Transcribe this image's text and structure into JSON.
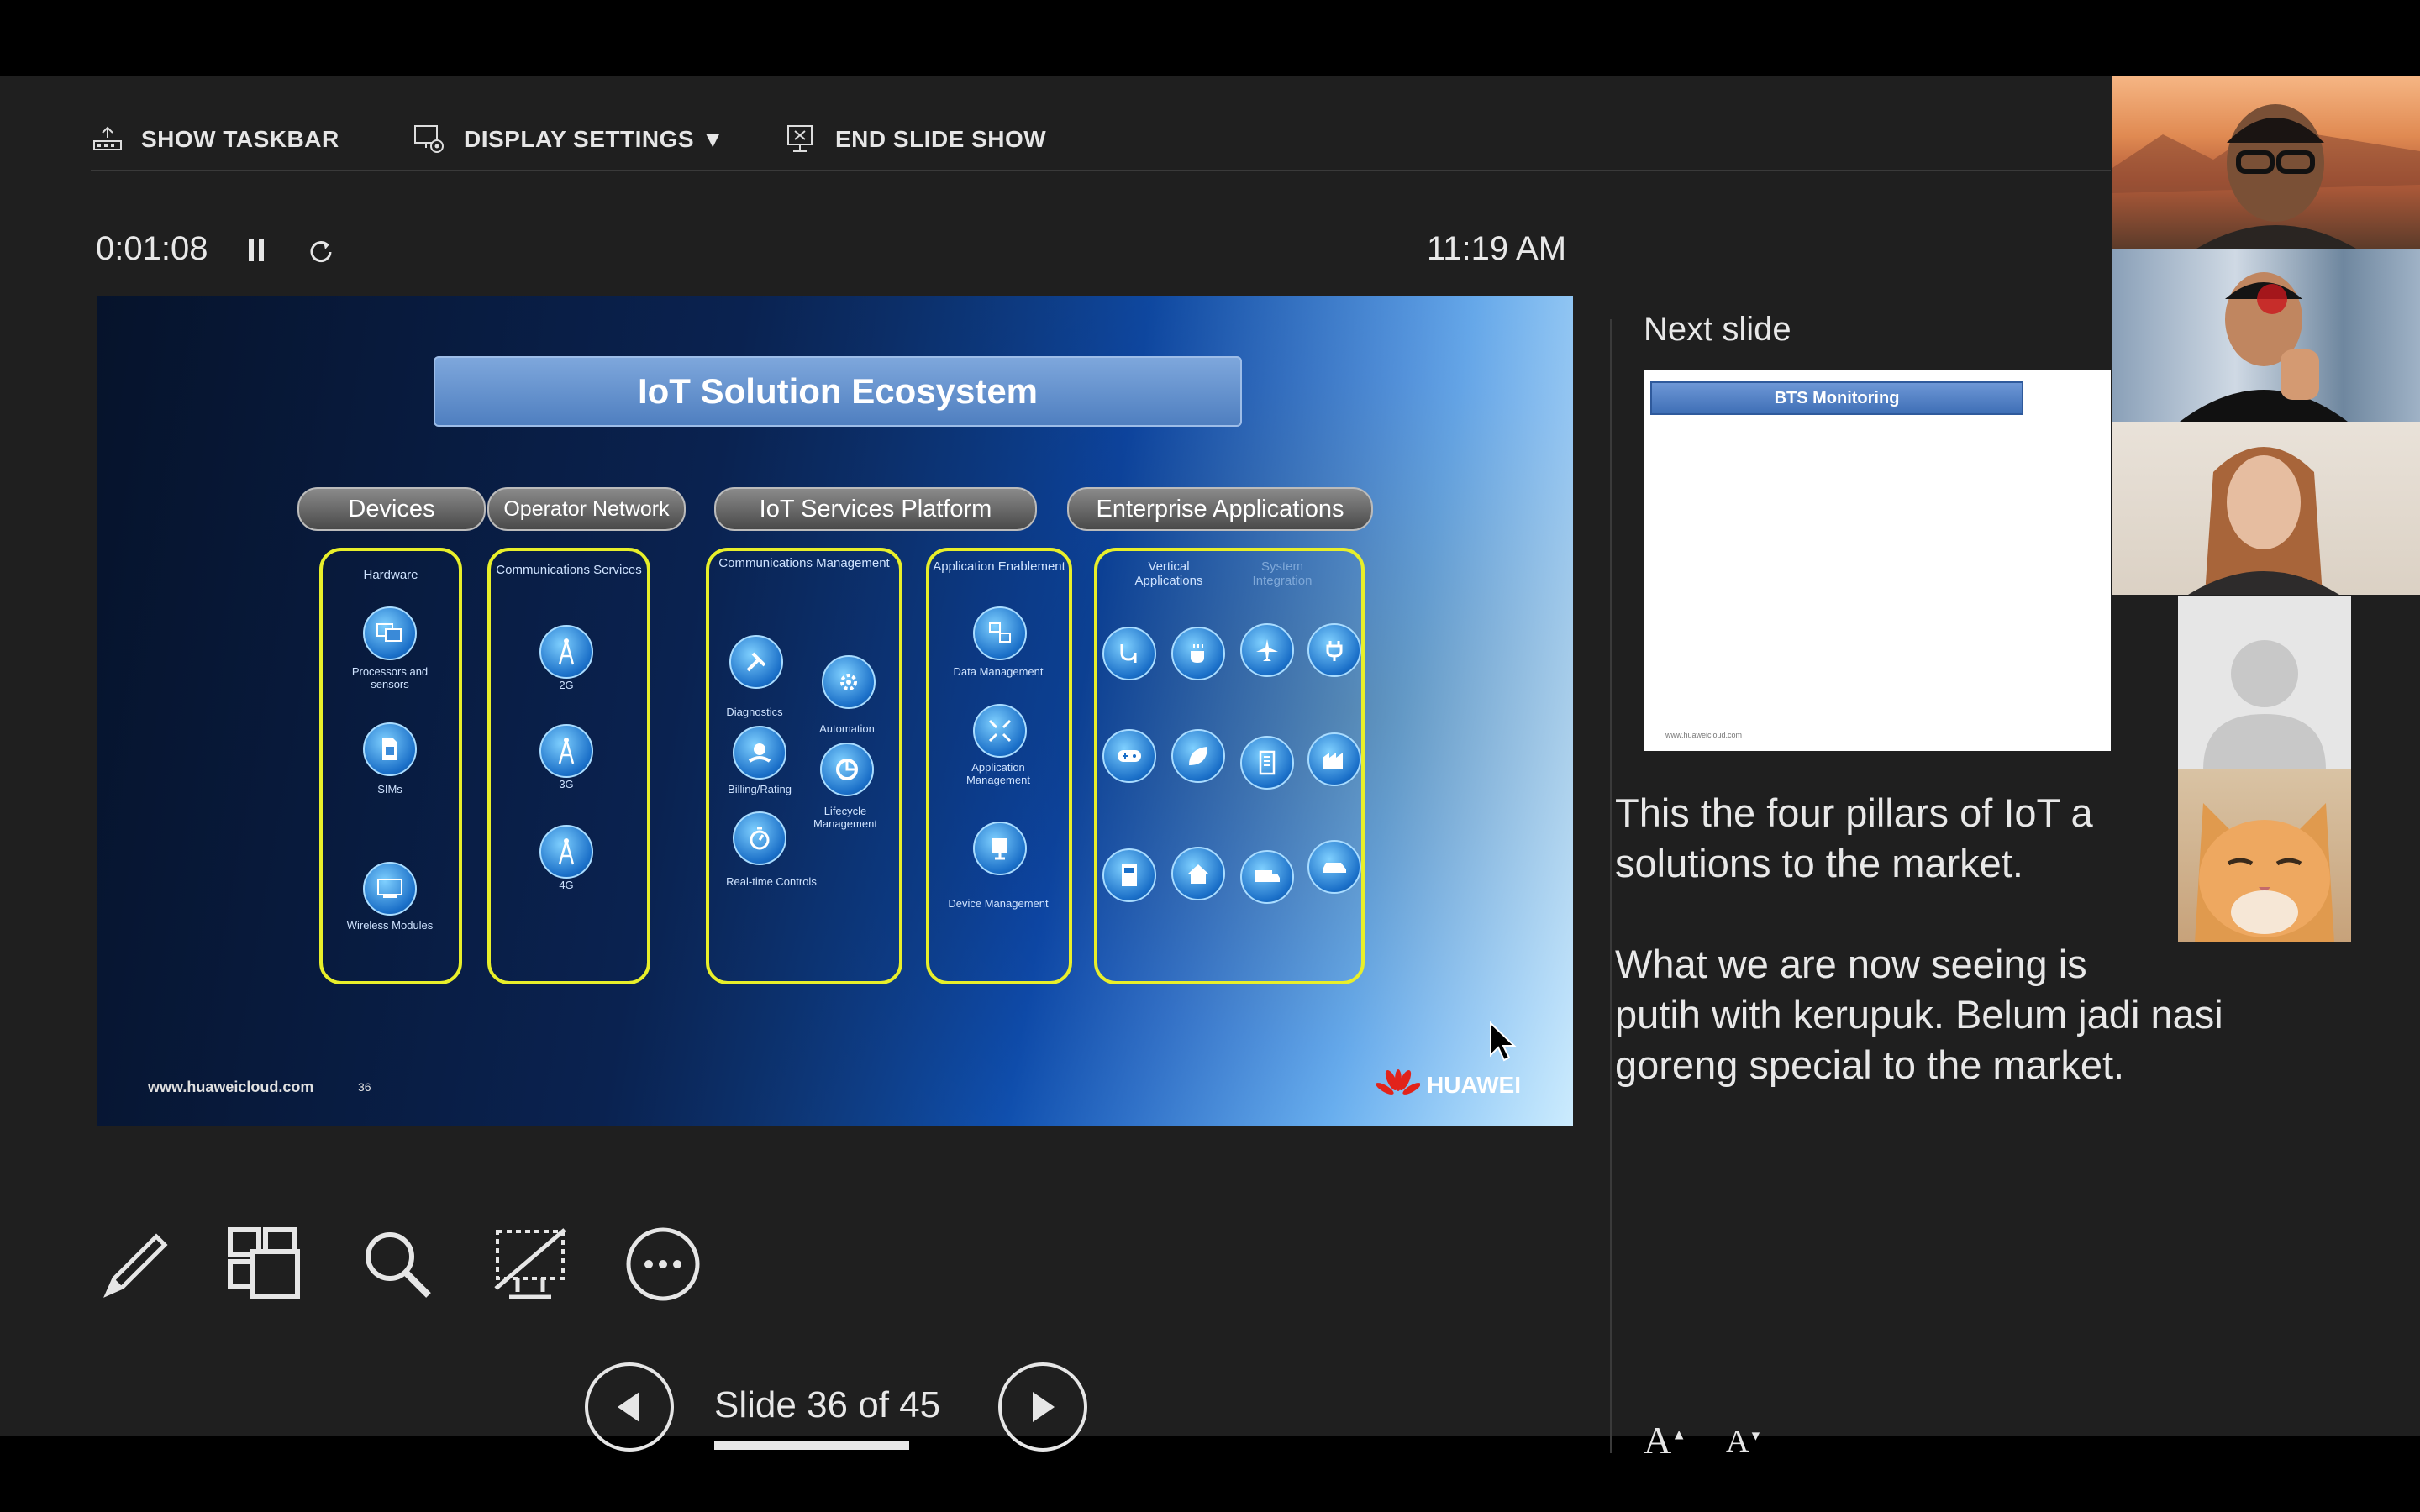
{
  "toolbar": {
    "show_taskbar": "SHOW TASKBAR",
    "display_settings": "DISPLAY SETTINGS ▼",
    "end_slide_show": "END SLIDE SHOW"
  },
  "presenter": {
    "timer": "0:01:08",
    "clock": "11:19 AM",
    "next_label": "Next slide",
    "slide_counter": "Slide 36 of 45",
    "progress": 0.8
  },
  "slide": {
    "title": "IoT Solution Ecosystem",
    "pillars": [
      "Devices",
      "Operator Network",
      "IoT Services Platform",
      "Enterprise  Applications"
    ],
    "hardware": {
      "head": "Hardware",
      "items": [
        "Processors and sensors",
        "SIMs",
        "Wireless Modules"
      ]
    },
    "comms": {
      "head": "Communications Services",
      "items": [
        "2G",
        "3G",
        "4G"
      ]
    },
    "cm": {
      "head": "Communications Management",
      "items": [
        "Diagnostics",
        "Automation",
        "Billing/Rating",
        "Lifecycle Management",
        "Real-time Controls"
      ]
    },
    "ae": {
      "head": "Application Enablement",
      "items": [
        "Data Management",
        "Application Management",
        "Device Management"
      ]
    },
    "ent": {
      "head_left": "Vertical Applications",
      "head_right": "System Integration"
    },
    "url": "www.huaweicloud.com",
    "number": "36",
    "brand": "HUAWEI"
  },
  "next_slide": {
    "title": "BTS Monitoring",
    "url": "www.huaweicloud.com"
  },
  "notes": "This the four pillars of IoT a\nsolutions to the market.\n\nWhat we are now seeing is\nputih with kerupuk. Belum jadi nasi\ngoreng special to the market.",
  "font_buttons": {
    "increase": "A",
    "decrease": "A"
  },
  "colors": {
    "background": "#1f1f1f",
    "column_border": "#e8ef2a",
    "title_box": "#5b8bd0"
  }
}
